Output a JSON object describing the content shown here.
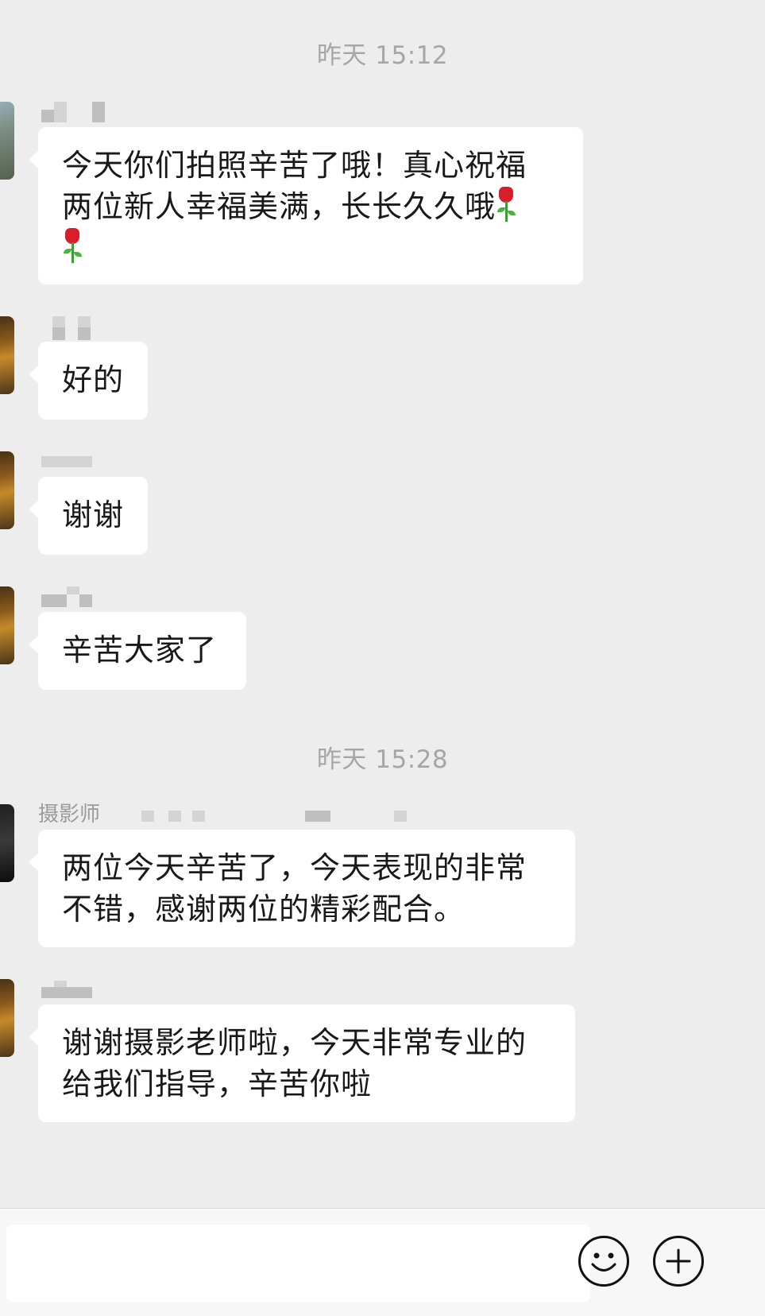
{
  "timestamps": [
    "昨天 15:12",
    "昨天 15:28"
  ],
  "messages": [
    {
      "text": "今天你们拍照辛苦了哦！真心祝福\n两位新人幸福美满，长长久久哦",
      "emoji": "rose"
    },
    {
      "text": "好的"
    },
    {
      "text": "谢谢"
    },
    {
      "text": "辛苦大家了"
    },
    {
      "nickname": "摄影师",
      "text": "两位今天辛苦了，今天表现的非常\n不错，感谢两位的精彩配合。"
    },
    {
      "text": "谢谢摄影老师啦，今天非常专业的\n给我们指导，辛苦你啦"
    }
  ],
  "toolbar": {
    "emoji_icon": "smiley-face-icon",
    "more_icon": "plus-circle-icon"
  }
}
